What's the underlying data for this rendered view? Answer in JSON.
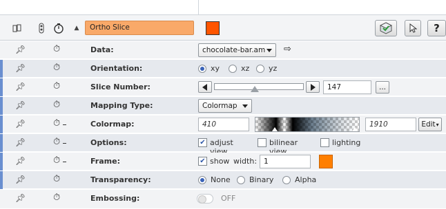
{
  "header": {
    "module_name": "Ortho Slice",
    "module_color": "#ff5500",
    "icons": [
      "dock-icon",
      "port-icon",
      "timer-icon",
      "collapse-arrow-icon"
    ],
    "tool_buttons": [
      "viewer-toggle-icon",
      "pointer-icon",
      "help-icon"
    ],
    "help_label": "?"
  },
  "rows": {
    "data": {
      "label": "Data:",
      "value": "chocolate-bar.am"
    },
    "orientation": {
      "label": "Orientation:",
      "options": [
        "xy",
        "xz",
        "yz"
      ],
      "selected": "xy"
    },
    "slice_number": {
      "label": "Slice Number:",
      "value": "147",
      "slider_fraction": 0.45,
      "more_label": "..."
    },
    "mapping_type": {
      "label": "Mapping Type:",
      "value": "Colormap"
    },
    "colormap": {
      "label": "Colormap:",
      "min": "410",
      "max": "1910",
      "edit_label": "Edit"
    },
    "options": {
      "label": "Options:",
      "items": [
        {
          "label": "adjust view",
          "checked": true
        },
        {
          "label": "bilinear view",
          "checked": false
        },
        {
          "label": "lighting",
          "checked": false
        }
      ]
    },
    "frame": {
      "label": "Frame:",
      "show_label": "show",
      "show_checked": true,
      "width_label": "width:",
      "width_value": "1",
      "frame_color": "#ff7f00"
    },
    "transparency": {
      "label": "Transparency:",
      "options": [
        "None",
        "Binary",
        "Alpha"
      ],
      "selected": "None"
    },
    "embossing": {
      "label": "Embossing:",
      "state": "OFF"
    }
  }
}
